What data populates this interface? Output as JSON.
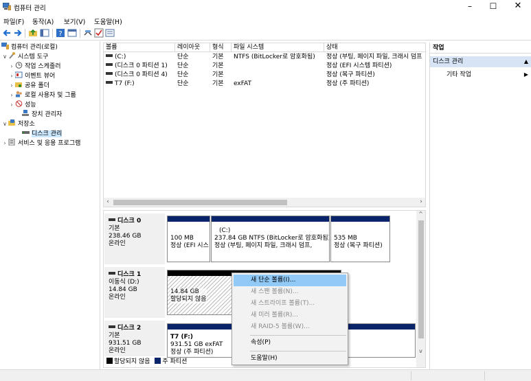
{
  "window": {
    "title": "컴퓨터 관리",
    "controls": {
      "minimize": "–",
      "maximize": "☐",
      "close": "✕"
    }
  },
  "menu": [
    "파일(F)",
    "동작(A)",
    "보기(V)",
    "도움말(H)"
  ],
  "toolbar_icons": [
    "back-arrow-icon",
    "forward-arrow-icon",
    "up-folder-icon",
    "show-tree-icon",
    "help-icon",
    "properties-icon",
    "connect-icon",
    "check-icon",
    "view-icon"
  ],
  "tree": {
    "root": "컴퓨터 관리(로컬)",
    "system_tools": "시스템 도구",
    "task_scheduler": "작업 스케줄러",
    "event_viewer": "이벤트 뷰어",
    "shared_folders": "공유 폴더",
    "local_users": "로컬 사용자 및 그룹",
    "performance": "성능",
    "device_manager": "장치 관리자",
    "storage": "저장소",
    "disk_management": "디스크 관리",
    "services": "서비스 및 응용 프로그램"
  },
  "volume_list": {
    "headers": [
      "볼륨",
      "레이아웃",
      "형식",
      "파일 시스템",
      "상태"
    ],
    "rows": [
      [
        "(C:)",
        "단순",
        "기본",
        "NTFS (BitLocker로 암호화됨)",
        "정상 (부팅, 페이지 파일, 크래시 덤프"
      ],
      [
        "(디스크 0 파티션 1)",
        "단순",
        "기본",
        "",
        "정상 (EFI 시스템 파티션)"
      ],
      [
        "(디스크 0 파티션 4)",
        "단순",
        "기본",
        "",
        "정상 (복구 파티션)"
      ],
      [
        "T7 (F:)",
        "단순",
        "기본",
        "exFAT",
        "정상 (주 파티션)"
      ]
    ]
  },
  "disks": [
    {
      "name": "디스크 0",
      "type": "기본",
      "size": "238.46 GB",
      "status": "온라인",
      "partitions": [
        {
          "line1": "",
          "line2": "100 MB",
          "line3": "정상 (EFI 시스",
          "color": "#0a246a"
        },
        {
          "line1": "(C:)",
          "line2": "237.84 GB NTFS (BitLocker로 암호화됨)",
          "line3": "정상 (부팅, 페이지 파일, 크래시 덤프,",
          "color": "#0a246a"
        },
        {
          "line1": "",
          "line2": "535 MB",
          "line3": "정상 (복구 파티션)",
          "color": "#0a246a"
        }
      ]
    },
    {
      "name": "디스크 1",
      "type": "이동식 (D:)",
      "size": "14.84 GB",
      "status": "온라인",
      "partitions": [
        {
          "line1": "",
          "line2": "14.84 GB",
          "line3": "할당되지 않음",
          "color": "#000000"
        }
      ]
    },
    {
      "name": "디스크 2",
      "type": "기본",
      "size": "931.51 GB",
      "status": "온라인",
      "partitions": [
        {
          "line1": "T7  (F:)",
          "line2": "931.51 GB exFAT",
          "line3": "정상 (주 파티션)",
          "color": "#0a246a"
        }
      ]
    }
  ],
  "legend": [
    {
      "label": "할당되지 않음",
      "color": "#000000"
    },
    {
      "label": "주 파티션",
      "color": "#0a246a"
    }
  ],
  "actions": {
    "header": "작업",
    "group": "디스크 관리",
    "item": "기타 작업"
  },
  "context_menu": {
    "items": [
      {
        "label": "새 단순 볼륨(I)...",
        "enabled": true,
        "highlighted": true
      },
      {
        "label": "새 스팬 볼륨(N)...",
        "enabled": false
      },
      {
        "label": "새 스트라이프 볼륨(T)...",
        "enabled": false
      },
      {
        "label": "새 미러 볼륨(R)...",
        "enabled": false
      },
      {
        "label": "새 RAID-5 볼륨(W)...",
        "enabled": false
      },
      {
        "label": "속성(P)",
        "enabled": true
      },
      {
        "label": "도움말(H)",
        "enabled": true
      }
    ]
  },
  "colors": {
    "accent_blue": "#0a246a",
    "selection": "#cce8ff",
    "menu_highlight": "#91c9f7"
  }
}
